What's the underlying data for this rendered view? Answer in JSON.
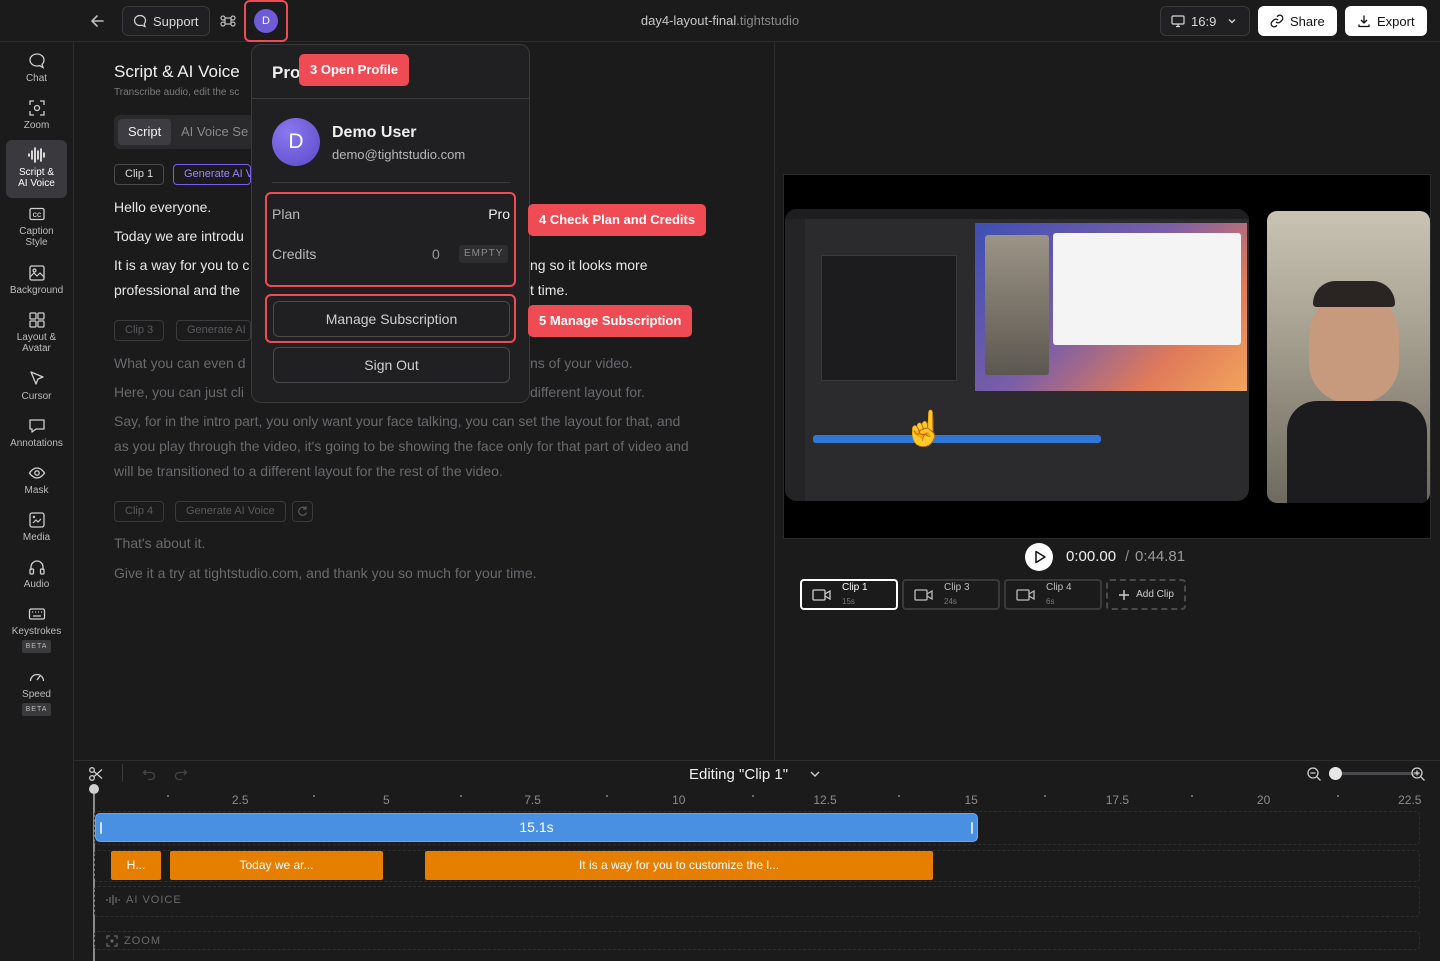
{
  "topbar": {
    "support_label": "Support",
    "avatar_initial": "D",
    "title": "day4-layout-final",
    "title_ext": ".tightstudio",
    "ratio_label": "16:9",
    "share_label": "Share",
    "export_label": "Export"
  },
  "rail": [
    {
      "label": "Chat"
    },
    {
      "label": "Zoom"
    },
    {
      "label": "Script & AI Voice"
    },
    {
      "label": "Caption Style"
    },
    {
      "label": "Background"
    },
    {
      "label": "Layout & Avatar"
    },
    {
      "label": "Cursor"
    },
    {
      "label": "Annotations"
    },
    {
      "label": "Mask"
    },
    {
      "label": "Media"
    },
    {
      "label": "Audio"
    },
    {
      "label": "Keystrokes",
      "badge": "BETA"
    },
    {
      "label": "Speed",
      "badge": "BETA"
    }
  ],
  "script": {
    "title": "Script & AI Voice",
    "subtitle": "Transcribe audio, edit the sc",
    "tab_script": "Script",
    "tab_voice": "AI Voice Se",
    "clip1": "Clip 1",
    "generate1": "Generate AI V",
    "lines1": [
      "Hello everyone.",
      "Today we are introdu",
      "It is a way for you to c",
      "professional and the"
    ],
    "lines1_tail": [
      "ng so it looks more",
      "t time."
    ],
    "clip3": "Clip 3",
    "generate3": "Generate AI",
    "lines3": [
      "What you can even d",
      "Here, you can just cli"
    ],
    "lines3_tail": [
      "ns of your video.",
      "different layout for."
    ],
    "para3": [
      "Say, for in the intro part, you only want your face talking, you can set the layout for that, and",
      "as you play through the video, it's going to be showing the face only for that part of video and",
      "will be transitioned to a different layout for the rest of the video."
    ],
    "clip4": "Clip 4",
    "generate4": "Generate AI Voice",
    "lines4": [
      "That's about it.",
      "Give it a try at tightstudio.com, and thank you so much for your time."
    ]
  },
  "player": {
    "current": "0:00.00",
    "separator": "/",
    "total": "0:44.81",
    "clips": [
      {
        "name": "Clip 1",
        "dur": "15s"
      },
      {
        "name": "Clip 3",
        "dur": "24s"
      },
      {
        "name": "Clip 4",
        "dur": "6s"
      }
    ],
    "add_clip": "Add Clip"
  },
  "timeline": {
    "editing_label": "Editing \"Clip 1\"",
    "ticks": [
      "2.5",
      "5",
      "7.5",
      "10",
      "12.5",
      "15",
      "17.5",
      "20",
      "22.5"
    ],
    "zoom_level": 0.0,
    "clip_bar_label": "15.1s",
    "segments": [
      "H...",
      "Today we ar...",
      "It is a way for you to customize the l..."
    ],
    "ai_voice_label": "AI VOICE",
    "zoom_track_label": "ZOOM"
  },
  "popup": {
    "header": "Pro",
    "user_initial": "D",
    "user_name": "Demo User",
    "user_email": "demo@tightstudio.com",
    "plan_label": "Plan",
    "plan_value": "Pro",
    "credits_label": "Credits",
    "credits_value": "0",
    "credits_badge": "EMPTY",
    "manage_label": "Manage Subscription",
    "signout_label": "Sign Out"
  },
  "callouts": {
    "open_profile": "3 Open Profile",
    "check_plan": "4 Check Plan and Credits",
    "manage_sub": "5 Manage Subscription"
  },
  "colors": {
    "accent_blue": "#4a90e2",
    "segment_orange": "#e67e00",
    "callout_red": "#ef4b55",
    "avatar_purple": "#6d5cd6"
  }
}
